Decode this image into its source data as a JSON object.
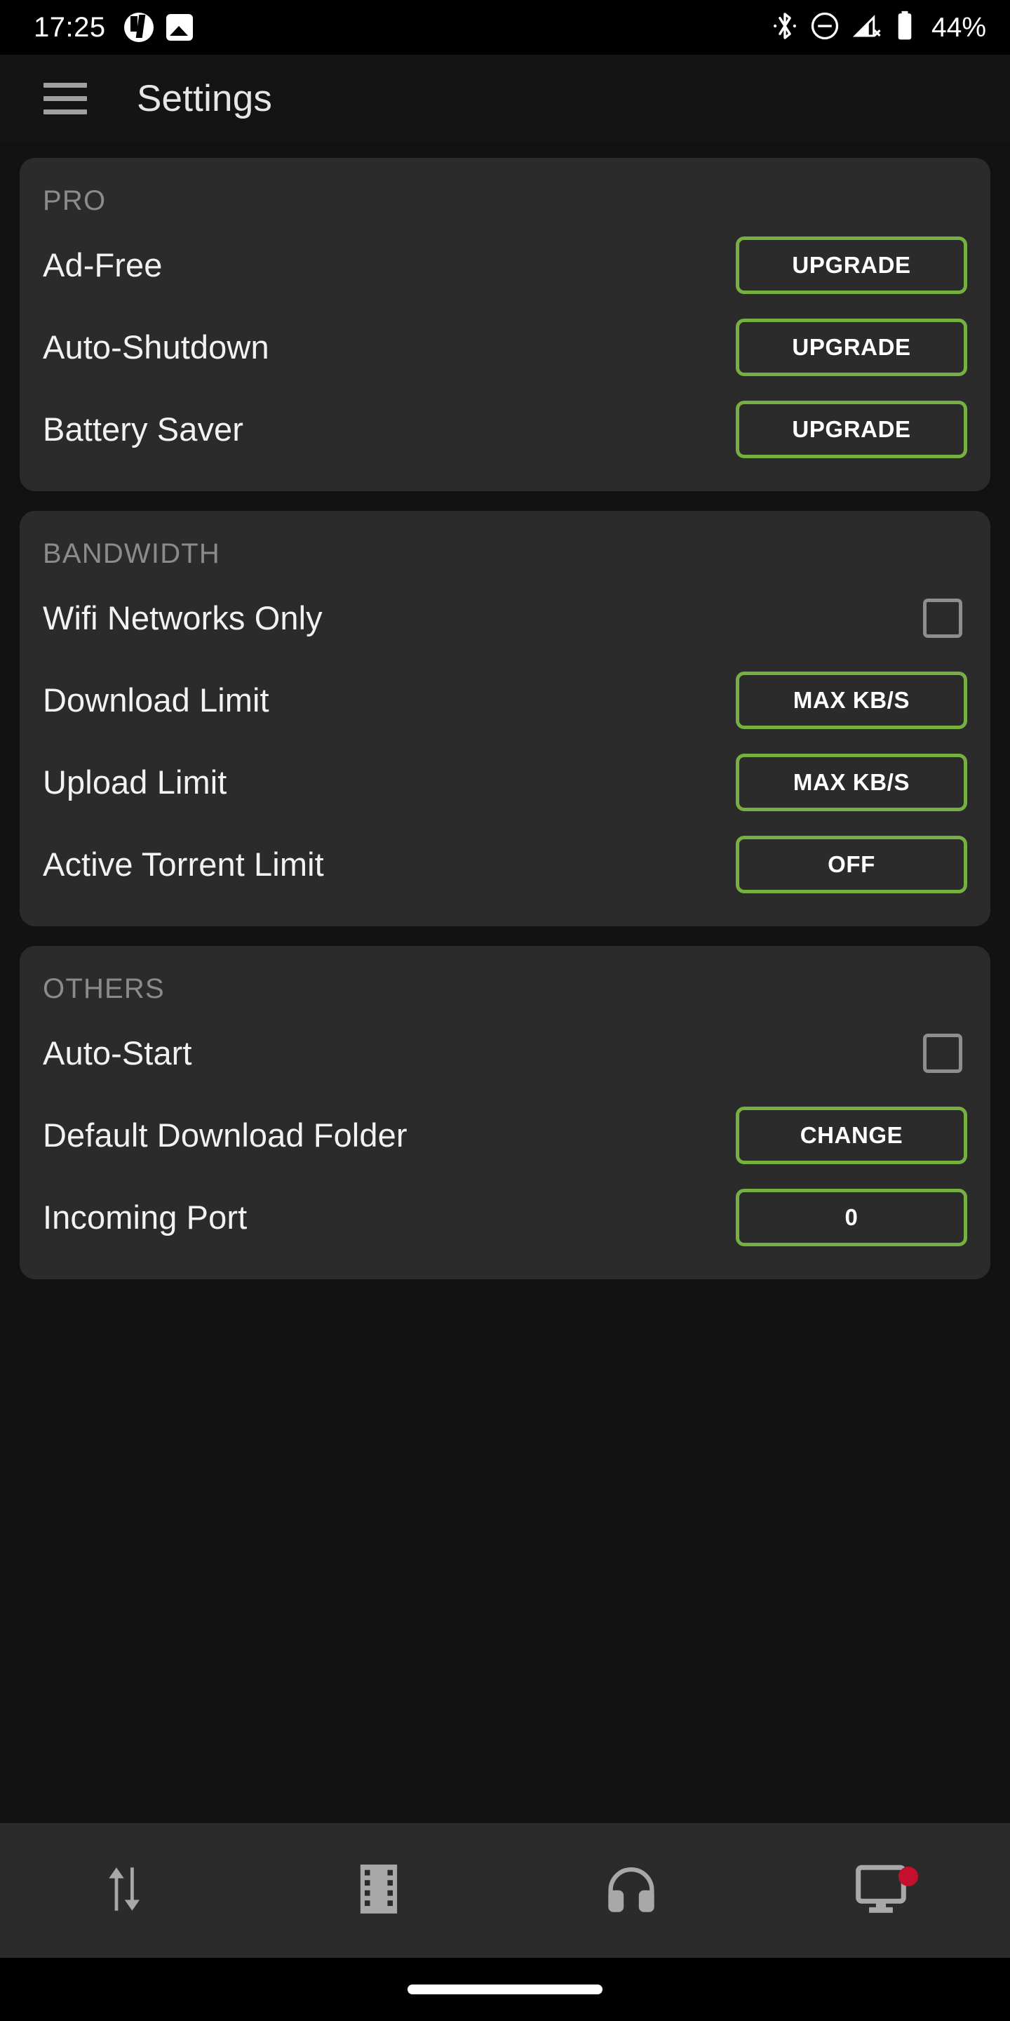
{
  "statusbar": {
    "time": "17:25",
    "left_icons": [
      "utorrent-icon",
      "gallery-icon"
    ],
    "right_icons": [
      "bluetooth-icon",
      "do-not-disturb-icon",
      "signal-off-icon",
      "battery-icon"
    ],
    "battery_percent": "44%"
  },
  "appbar": {
    "menu_icon": "hamburger-menu-icon",
    "title": "Settings"
  },
  "colors": {
    "accent_green": "#76b043",
    "card_bg": "#2b2b2b",
    "page_bg": "#121212",
    "badge_red": "#c2102e",
    "label_text": "#f2f2f2",
    "section_text": "#8b8b8b"
  },
  "sections": [
    {
      "title": "PRO",
      "rows": [
        {
          "label": "Ad-Free",
          "control": "button",
          "value": "UPGRADE"
        },
        {
          "label": "Auto-Shutdown",
          "control": "button",
          "value": "UPGRADE"
        },
        {
          "label": "Battery Saver",
          "control": "button",
          "value": "UPGRADE"
        }
      ]
    },
    {
      "title": "BANDWIDTH",
      "rows": [
        {
          "label": "Wifi Networks Only",
          "control": "checkbox",
          "checked": false
        },
        {
          "label": "Download Limit",
          "control": "button",
          "value": "MAX KB/S"
        },
        {
          "label": "Upload Limit",
          "control": "button",
          "value": "MAX KB/S"
        },
        {
          "label": "Active Torrent Limit",
          "control": "button",
          "value": "OFF"
        }
      ]
    },
    {
      "title": "OTHERS",
      "rows": [
        {
          "label": "Auto-Start",
          "control": "checkbox",
          "checked": false
        },
        {
          "label": "Default Download Folder",
          "control": "button",
          "value": "CHANGE"
        },
        {
          "label": "Incoming Port",
          "control": "button",
          "value": "0"
        }
      ]
    }
  ],
  "bottomnav": {
    "items": [
      {
        "icon": "transfers-icon",
        "badge": false
      },
      {
        "icon": "film-icon",
        "badge": false
      },
      {
        "icon": "headphones-icon",
        "badge": false
      },
      {
        "icon": "monitor-icon",
        "badge": true
      }
    ]
  }
}
